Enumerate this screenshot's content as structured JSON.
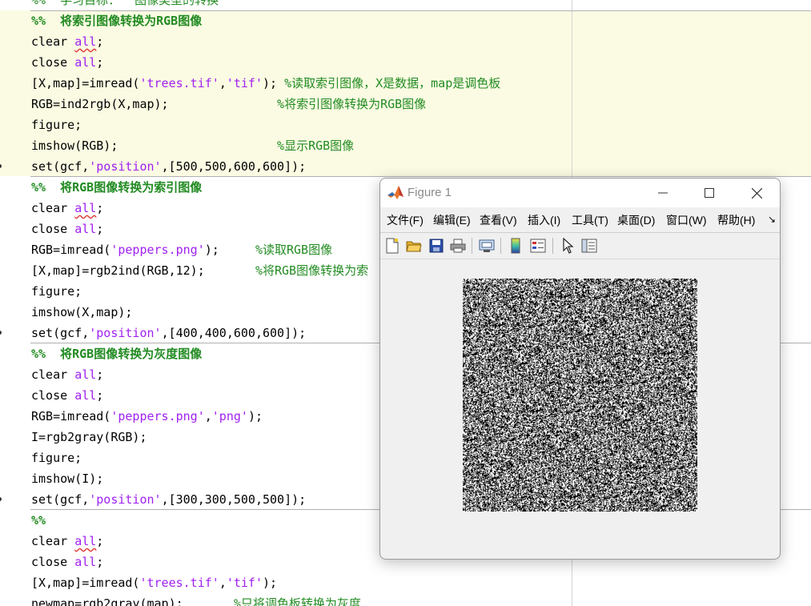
{
  "editor": {
    "lines": [
      {
        "type": "partial",
        "tokens": [
          {
            "t": "%%  学习目标：  图像类型的转换",
            "c": "cmt"
          }
        ]
      },
      {
        "type": "section",
        "tokens": [
          {
            "t": "%%  将索引图像转换为RGB图像",
            "c": "sec"
          }
        ]
      },
      {
        "type": "code",
        "tokens": [
          {
            "t": "clear ",
            "c": "kw"
          },
          {
            "t": "all",
            "c": "cmd"
          },
          {
            "t": ";",
            "c": "kw"
          }
        ]
      },
      {
        "type": "code",
        "tokens": [
          {
            "t": "close ",
            "c": "kw"
          },
          {
            "t": "all",
            "c": "str"
          },
          {
            "t": ";",
            "c": "kw"
          }
        ]
      },
      {
        "type": "code",
        "tokens": [
          {
            "t": "[X,map]=imread(",
            "c": "kw"
          },
          {
            "t": "'trees.tif'",
            "c": "str"
          },
          {
            "t": ",",
            "c": "kw"
          },
          {
            "t": "'tif'",
            "c": "str"
          },
          {
            "t": "); ",
            "c": "kw"
          },
          {
            "t": "%读取索引图像，X是数据，map是调色板",
            "c": "cmt"
          }
        ]
      },
      {
        "type": "code",
        "tokens": [
          {
            "t": "RGB=ind2rgb(X,map);               ",
            "c": "kw"
          },
          {
            "t": "%将索引图像转换为RGB图像",
            "c": "cmt"
          }
        ]
      },
      {
        "type": "code",
        "tokens": [
          {
            "t": "figure;",
            "c": "kw"
          }
        ]
      },
      {
        "type": "code",
        "tokens": [
          {
            "t": "imshow(RGB);                      ",
            "c": "kw"
          },
          {
            "t": "%显示RGB图像",
            "c": "cmt"
          }
        ]
      },
      {
        "type": "code",
        "tokens": [
          {
            "t": "set(gcf,",
            "c": "kw"
          },
          {
            "t": "'position'",
            "c": "str"
          },
          {
            "t": ",[500,500,600,600]);",
            "c": "kw"
          }
        ]
      },
      {
        "type": "section",
        "tokens": [
          {
            "t": "%%  将RGB图像转换为索引图像",
            "c": "sec"
          }
        ]
      },
      {
        "type": "code",
        "tokens": [
          {
            "t": "clear ",
            "c": "kw"
          },
          {
            "t": "all",
            "c": "cmd"
          },
          {
            "t": ";",
            "c": "kw"
          }
        ]
      },
      {
        "type": "code",
        "tokens": [
          {
            "t": "close ",
            "c": "kw"
          },
          {
            "t": "all",
            "c": "str"
          },
          {
            "t": ";",
            "c": "kw"
          }
        ]
      },
      {
        "type": "code",
        "tokens": [
          {
            "t": "RGB=imread(",
            "c": "kw"
          },
          {
            "t": "'peppers.png'",
            "c": "str"
          },
          {
            "t": ");     ",
            "c": "kw"
          },
          {
            "t": "%读取RGB图像",
            "c": "cmt"
          }
        ]
      },
      {
        "type": "code",
        "tokens": [
          {
            "t": "[X,map]=rgb2ind(RGB,12);       ",
            "c": "kw"
          },
          {
            "t": "%将RGB图像转换为索",
            "c": "cmt"
          }
        ]
      },
      {
        "type": "code",
        "tokens": [
          {
            "t": "figure;",
            "c": "kw"
          }
        ]
      },
      {
        "type": "code",
        "tokens": [
          {
            "t": "imshow(X,map);",
            "c": "kw"
          }
        ]
      },
      {
        "type": "code",
        "tokens": [
          {
            "t": "set(gcf,",
            "c": "kw"
          },
          {
            "t": "'position'",
            "c": "str"
          },
          {
            "t": ",[400,400,600,600]);",
            "c": "kw"
          }
        ]
      },
      {
        "type": "section",
        "tokens": [
          {
            "t": "%%  将RGB图像转换为灰度图像",
            "c": "sec"
          }
        ]
      },
      {
        "type": "code",
        "tokens": [
          {
            "t": "clear ",
            "c": "kw"
          },
          {
            "t": "all",
            "c": "str"
          },
          {
            "t": ";",
            "c": "kw"
          }
        ]
      },
      {
        "type": "code",
        "tokens": [
          {
            "t": "close ",
            "c": "kw"
          },
          {
            "t": "all",
            "c": "str"
          },
          {
            "t": ";",
            "c": "kw"
          }
        ]
      },
      {
        "type": "code",
        "tokens": [
          {
            "t": "RGB=imread(",
            "c": "kw"
          },
          {
            "t": "'peppers.png'",
            "c": "str"
          },
          {
            "t": ",",
            "c": "kw"
          },
          {
            "t": "'png'",
            "c": "str"
          },
          {
            "t": ");",
            "c": "kw"
          }
        ]
      },
      {
        "type": "code",
        "tokens": [
          {
            "t": "I=rgb2gray(RGB);",
            "c": "kw"
          }
        ]
      },
      {
        "type": "code",
        "tokens": [
          {
            "t": "figure;",
            "c": "kw"
          }
        ]
      },
      {
        "type": "code",
        "tokens": [
          {
            "t": "imshow(I);",
            "c": "kw"
          }
        ]
      },
      {
        "type": "code",
        "tokens": [
          {
            "t": "set(gcf,",
            "c": "kw"
          },
          {
            "t": "'position'",
            "c": "str"
          },
          {
            "t": ",[300,300,500,500]);",
            "c": "kw"
          }
        ]
      },
      {
        "type": "section",
        "tokens": [
          {
            "t": "%%",
            "c": "sec"
          }
        ]
      },
      {
        "type": "code",
        "tokens": [
          {
            "t": "clear ",
            "c": "kw"
          },
          {
            "t": "all",
            "c": "cmd"
          },
          {
            "t": ";",
            "c": "kw"
          }
        ]
      },
      {
        "type": "code",
        "tokens": [
          {
            "t": "close ",
            "c": "kw"
          },
          {
            "t": "all",
            "c": "str"
          },
          {
            "t": ";",
            "c": "kw"
          }
        ]
      },
      {
        "type": "code",
        "tokens": [
          {
            "t": "[X,map]=imread(",
            "c": "kw"
          },
          {
            "t": "'trees.tif'",
            "c": "str"
          },
          {
            "t": ",",
            "c": "kw"
          },
          {
            "t": "'tif'",
            "c": "str"
          },
          {
            "t": ");",
            "c": "kw"
          }
        ]
      },
      {
        "type": "code",
        "tokens": [
          {
            "t": "newmap=rgb2gray(map);       ",
            "c": "kw"
          },
          {
            "t": "%只将调色板转换为灰度",
            "c": "cmt"
          }
        ]
      }
    ]
  },
  "figure": {
    "title": "Figure 1",
    "menus": [
      "文件(F)",
      "编辑(E)",
      "查看(V)",
      "插入(I)",
      "工具(T)",
      "桌面(D)",
      "窗口(W)",
      "帮助(H)"
    ],
    "overflow_glyph": "↘",
    "window_buttons": {
      "minimize": "minimize-icon",
      "maximize": "maximize-icon",
      "close": "close-icon"
    },
    "toolbar": [
      {
        "name": "new-figure-icon"
      },
      {
        "name": "open-file-icon"
      },
      {
        "name": "save-icon"
      },
      {
        "name": "print-icon"
      },
      {
        "name": "link-plot-icon"
      },
      {
        "name": "insert-colorbar-icon"
      },
      {
        "name": "insert-legend-icon"
      },
      {
        "name": "edit-plot-icon"
      },
      {
        "name": "property-inspector-icon"
      }
    ],
    "image": {
      "description_colors": {
        "dark": "#000000",
        "light": "#ffffff"
      }
    }
  },
  "colors": {
    "active_cell_bg": "#fbfbe3",
    "string": "#a020f0",
    "comment": "#228b22",
    "section": "#228b22"
  }
}
